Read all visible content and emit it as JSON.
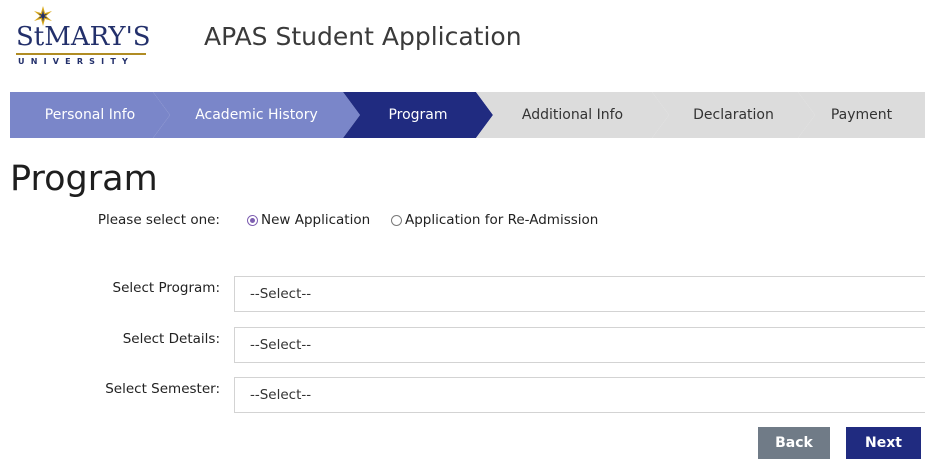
{
  "header": {
    "logo_main": "StMARY'S",
    "logo_sub": "UNIVERSITY",
    "app_title": "APAS Student Application",
    "logo_colors": {
      "navy": "#23306b",
      "gold": "#d9a91c"
    }
  },
  "steps": [
    {
      "label": "Personal Info",
      "state": "done"
    },
    {
      "label": "Academic History",
      "state": "done"
    },
    {
      "label": "Program",
      "state": "active"
    },
    {
      "label": "Additional Info",
      "state": "pending"
    },
    {
      "label": "Declaration",
      "state": "pending"
    },
    {
      "label": "Payment",
      "state": "pending"
    }
  ],
  "step_colors": {
    "done": "#7a86c9",
    "active": "#202b80",
    "pending": "#dcdcdc"
  },
  "page_title": "Program",
  "application_type": {
    "label": "Please select one:",
    "options": [
      {
        "label": "New Application",
        "selected": true
      },
      {
        "label": "Application for Re-Admission",
        "selected": false
      }
    ]
  },
  "fields": {
    "program": {
      "label": "Select Program:",
      "value": "--Select--"
    },
    "details": {
      "label": "Select Details:",
      "value": "--Select--"
    },
    "semester": {
      "label": "Select Semester:",
      "value": "--Select--"
    }
  },
  "buttons": {
    "back": "Back",
    "next": "Next"
  }
}
